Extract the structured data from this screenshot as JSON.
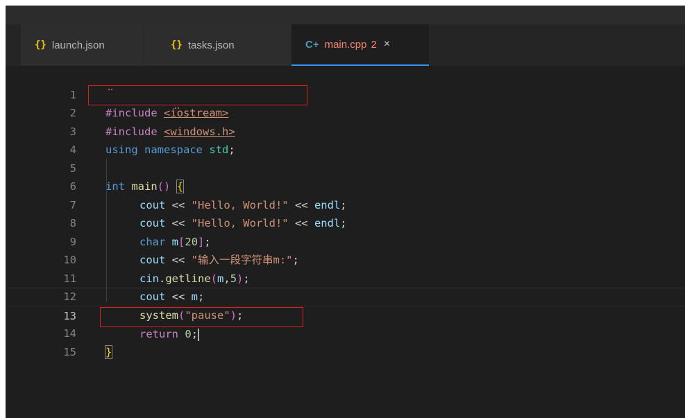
{
  "tabs": [
    {
      "label": "launch.json",
      "icon": "json-braces-icon"
    },
    {
      "label": "tasks.json",
      "icon": "json-braces-icon"
    },
    {
      "label": "main.cpp",
      "icon": "cpp-file-icon",
      "problems": "2",
      "close": "×",
      "active": true
    }
  ],
  "editor": {
    "active_line": 13,
    "line_numbers": [
      "1",
      "2",
      "3",
      "4",
      "5",
      "6",
      "7",
      "8",
      "9",
      "10",
      "11",
      "12",
      "13",
      "14",
      "15"
    ],
    "tokens": {
      "l1": [
        "#include",
        " ",
        "<iostream>"
      ],
      "l2": [
        "#include",
        " ",
        "<windows.h>"
      ],
      "l3": [
        "using",
        " ",
        "namespace",
        " ",
        "std",
        ";"
      ],
      "l5": [
        "int",
        " ",
        "main",
        "()",
        " ",
        "{"
      ],
      "l6": [
        "cout",
        " << ",
        "\"Hello, World!\"",
        " << ",
        "endl",
        ";"
      ],
      "l7": [
        "cout",
        " << ",
        "\"Hello, World!\"",
        " << ",
        "endl",
        ";"
      ],
      "l8": [
        "char",
        " ",
        "m",
        "[",
        "20",
        "]",
        ";"
      ],
      "l9": [
        "cout",
        " << ",
        "\"输入一段字符串m:\"",
        ";"
      ],
      "l10": [
        "cin",
        ".",
        "getline",
        "(",
        "m",
        ",",
        "5",
        ")",
        ";"
      ],
      "l11": [
        "cout",
        " << ",
        "m",
        ";"
      ],
      "l12": [
        "system",
        "(",
        "\"pause\"",
        ")",
        ";"
      ],
      "l13": [
        "return",
        " ",
        "0",
        ";"
      ],
      "l14": [
        "}"
      ]
    }
  },
  "highlight_color": "#e02020",
  "accent_color": "#3794ff"
}
